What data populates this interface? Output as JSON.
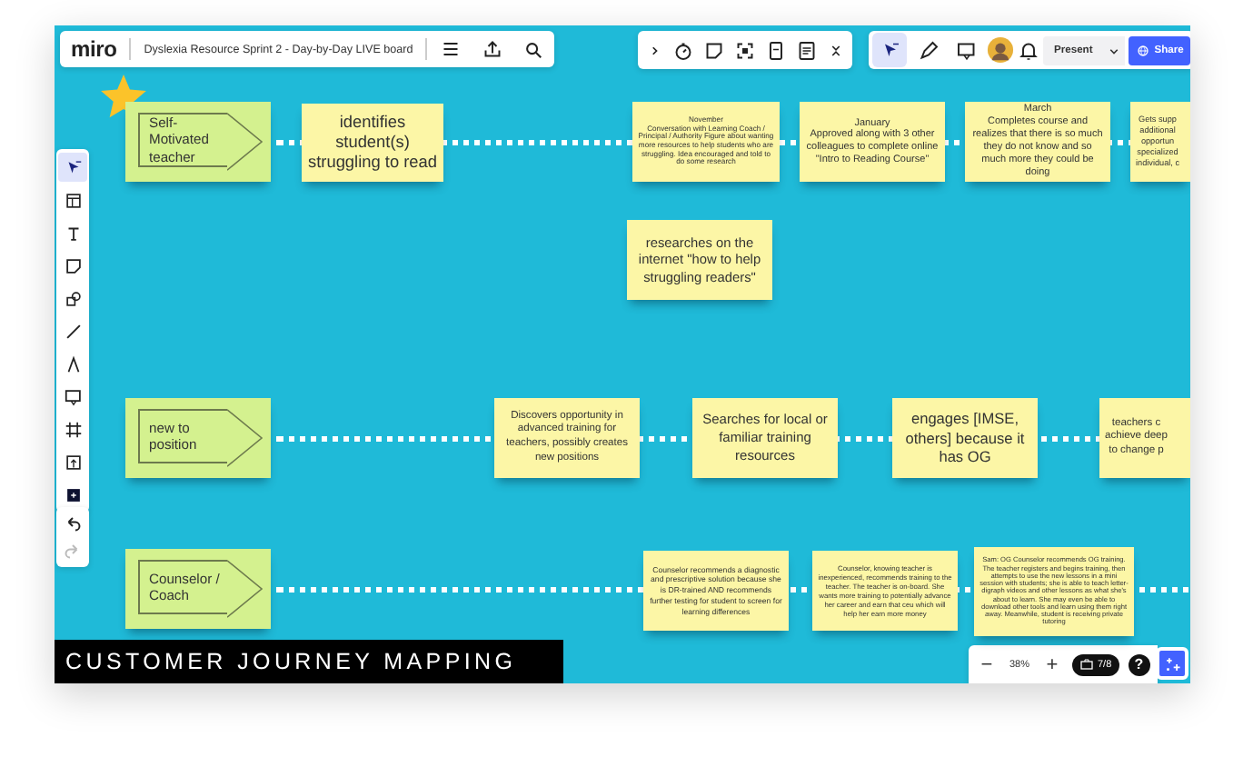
{
  "header": {
    "logo": "miro",
    "title": "Dyslexia Resource Sprint 2 - Day-by-Day LIVE board"
  },
  "collab_tools": [
    {
      "selected": true
    },
    {
      "selected": false
    },
    {
      "selected": false
    }
  ],
  "buttons": {
    "present": "Present",
    "share": "Share"
  },
  "left_tools": [
    {
      "selected": true
    },
    {
      "selected": false
    },
    {
      "selected": false
    },
    {
      "selected": false
    },
    {
      "selected": false
    },
    {
      "selected": false
    },
    {
      "selected": false
    },
    {
      "selected": false
    },
    {
      "selected": false
    },
    {
      "selected": false
    },
    {
      "selected": false
    }
  ],
  "lanes": [
    {
      "label": "Self-Motivated teacher",
      "stickies": [
        "identifies student(s) struggling to read",
        "November\nConversation with Learning Coach / Principal / Authority Figure about wanting more resources to help students who are struggling. Idea encouraged and told to do some research",
        "January\nApproved along with 3 other colleagues to complete online \"Intro to Reading Course\"",
        "March\nCompletes course and realizes that there is so much they do not know and so much more they could be doing",
        "Gets supp\nadditional\nopportun\nspecialized\nindividual, c",
        "researches on the internet \"how to help struggling readers\""
      ]
    },
    {
      "label": "new to position",
      "stickies": [
        "Discovers opportunity in advanced training for teachers, possibly creates new positions",
        "Searches for local or familiar training resources",
        "engages [IMSE, others] because it has OG",
        "teachers c\nachieve deep\nto change p"
      ]
    },
    {
      "label": "Counselor / Coach",
      "stickies": [
        "Counselor recommends a diagnostic and prescriptive solution because she is DR-trained AND recommends further testing for student to screen for learning differences",
        "Counselor, knowing teacher is inexperienced, recommends training to the teacher. The teacher is on-board. She wants more training to potentially advance her career and earn that ceu which will help her earn more money",
        "Sam: OG Counselor recommends OG training. The teacher registers and begins training, then attempts to use the new lessons in a mini session with students; she is able to teach letter-digraph videos and other lessons as what she's about to learn. She may even be able to download other tools and learn using them right away. Meanwhile, student is receiving private tutoring"
      ]
    }
  ],
  "banner": "CUSTOMER JOURNEY MAPPING",
  "zoom": {
    "minus": "−",
    "level": "38%",
    "plus": "+",
    "frames": "7/8",
    "help": "?"
  }
}
